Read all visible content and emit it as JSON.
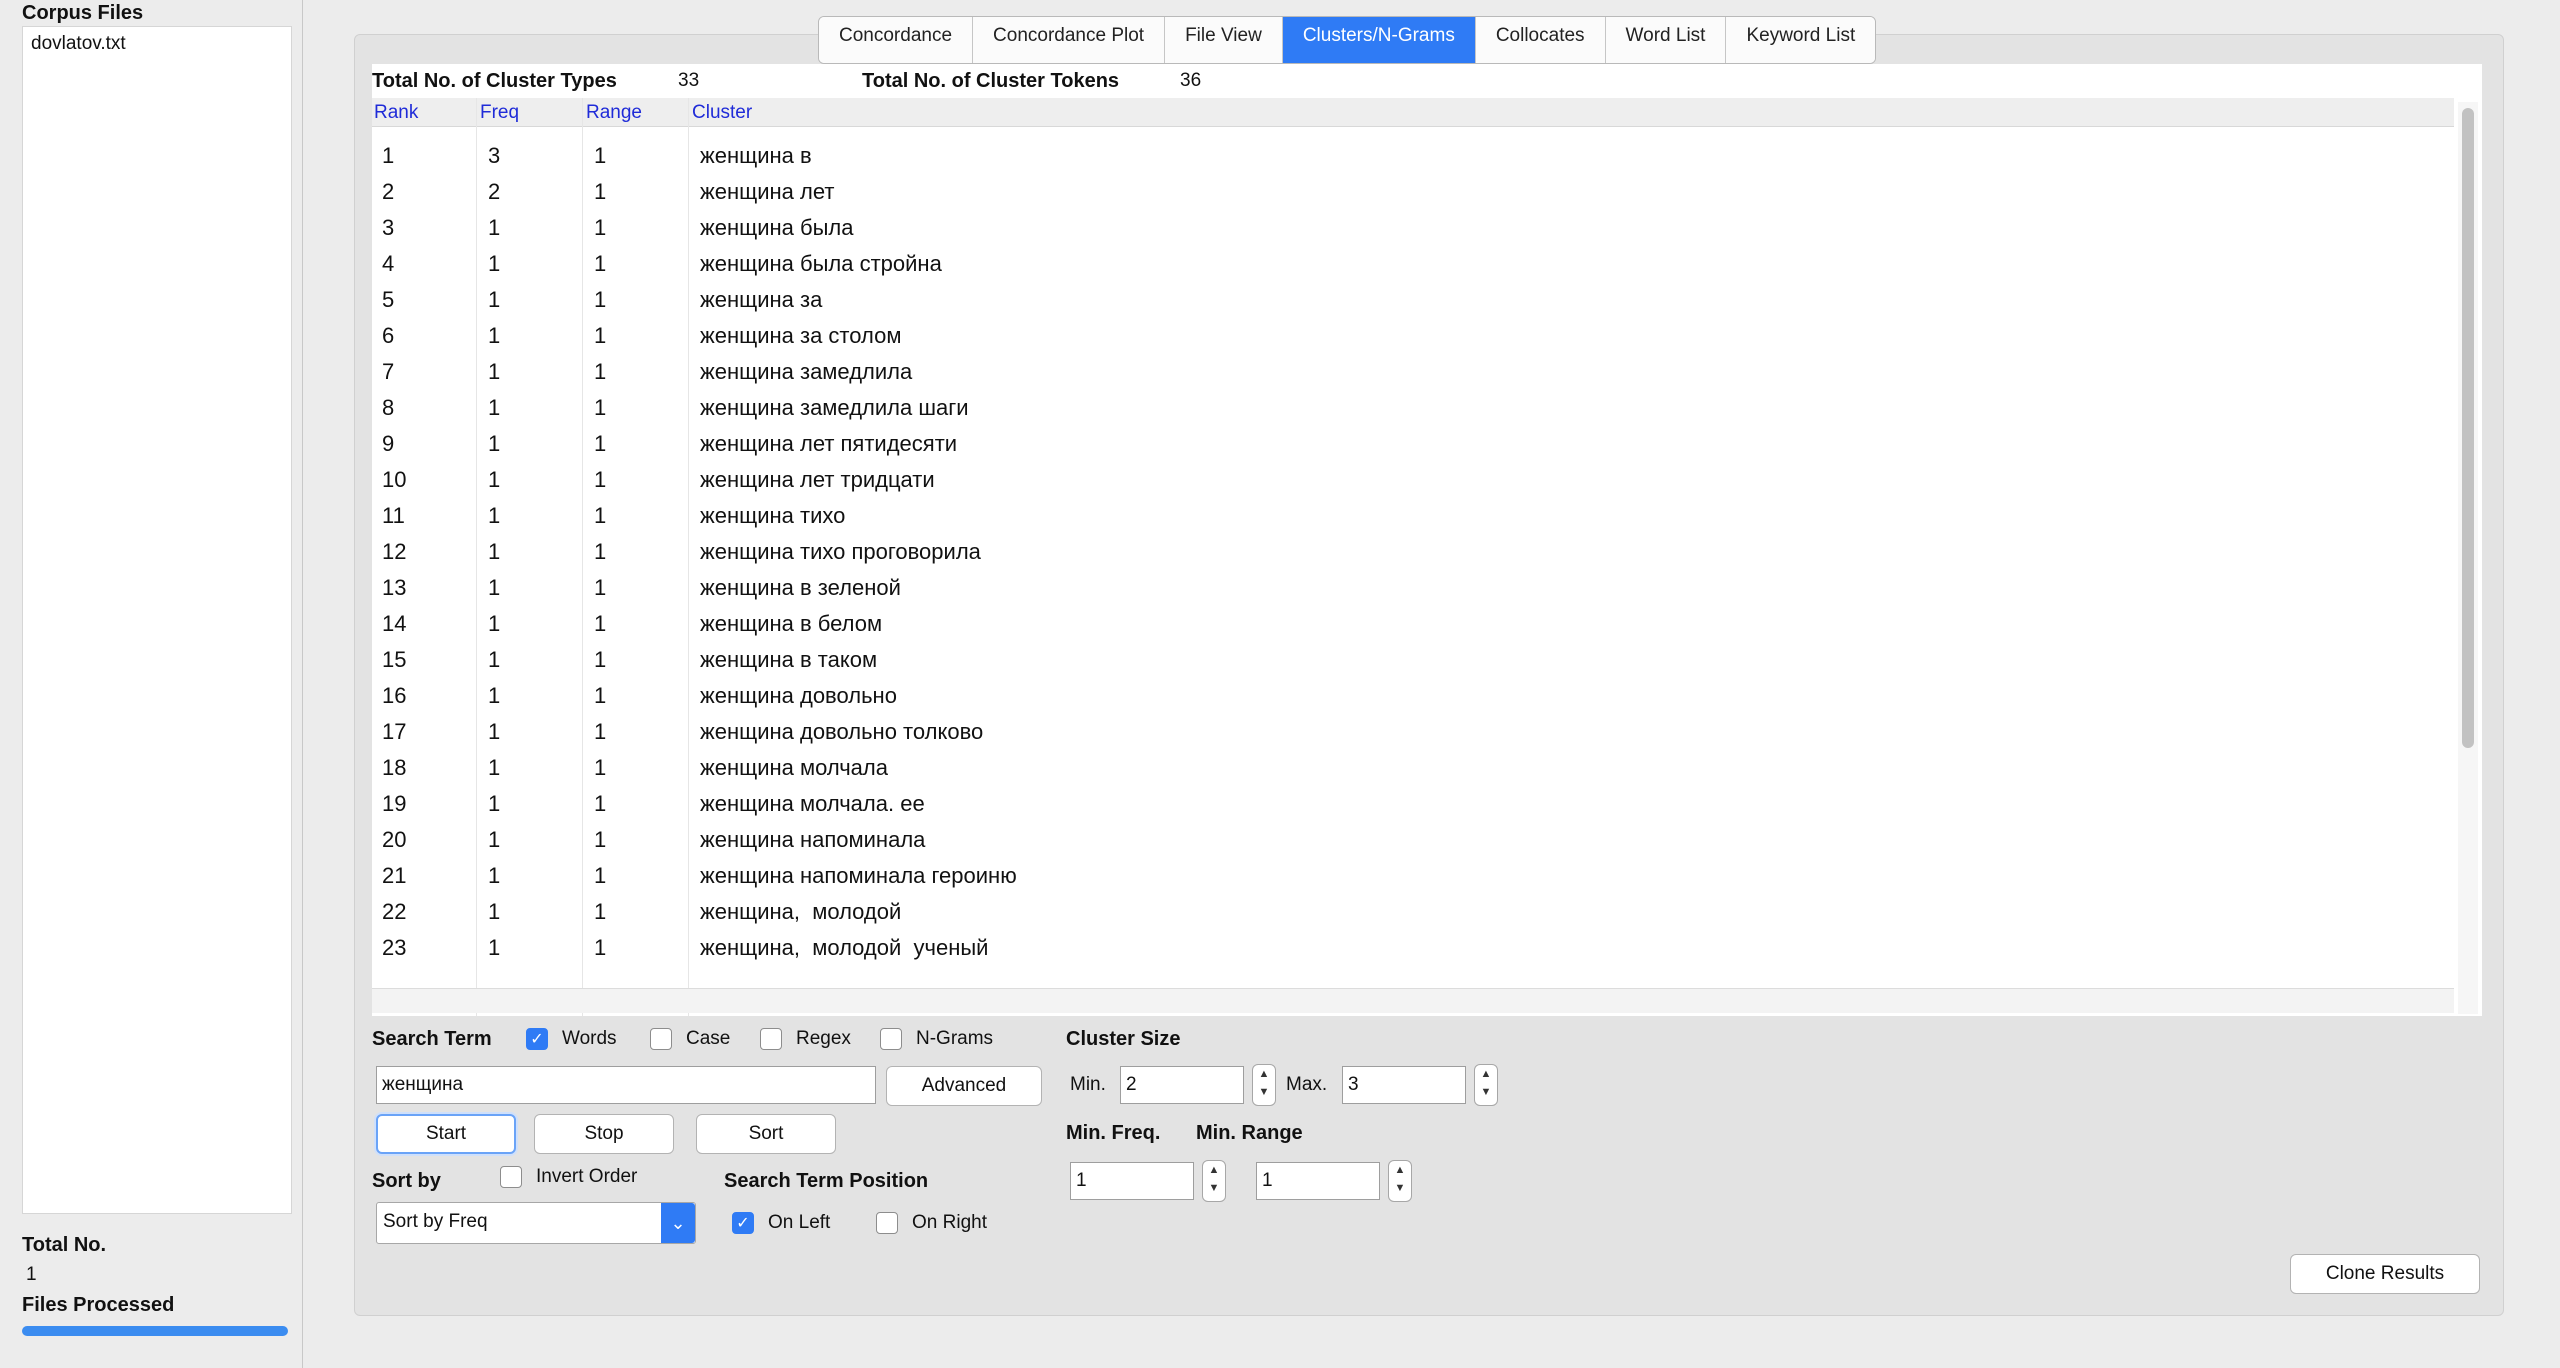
{
  "sidebar": {
    "corpus_title": "Corpus Files",
    "files": [
      "dovlatov.txt"
    ],
    "total_label": "Total No.",
    "total_value": "1",
    "processed_label": "Files Processed"
  },
  "tabs": [
    {
      "label": "Concordance",
      "active": false
    },
    {
      "label": "Concordance Plot",
      "active": false
    },
    {
      "label": "File View",
      "active": false
    },
    {
      "label": "Clusters/N-Grams",
      "active": true
    },
    {
      "label": "Collocates",
      "active": false
    },
    {
      "label": "Word List",
      "active": false
    },
    {
      "label": "Keyword List",
      "active": false
    }
  ],
  "stats": {
    "types_label": "Total No. of Cluster Types",
    "types_value": "33",
    "tokens_label": "Total No. of Cluster Tokens",
    "tokens_value": "36"
  },
  "table": {
    "headers": [
      "Rank",
      "Freq",
      "Range",
      "Cluster"
    ],
    "rows": [
      [
        "1",
        "3",
        "1",
        "женщина в"
      ],
      [
        "2",
        "2",
        "1",
        "женщина лет"
      ],
      [
        "3",
        "1",
        "1",
        "женщина была"
      ],
      [
        "4",
        "1",
        "1",
        "женщина была стройна"
      ],
      [
        "5",
        "1",
        "1",
        "женщина за"
      ],
      [
        "6",
        "1",
        "1",
        "женщина за столом"
      ],
      [
        "7",
        "1",
        "1",
        "женщина замедлила"
      ],
      [
        "8",
        "1",
        "1",
        "женщина замедлила шаги"
      ],
      [
        "9",
        "1",
        "1",
        "женщина лет пятидесяти"
      ],
      [
        "10",
        "1",
        "1",
        "женщина лет тридцати"
      ],
      [
        "11",
        "1",
        "1",
        "женщина тихо"
      ],
      [
        "12",
        "1",
        "1",
        "женщина тихо проговорила"
      ],
      [
        "13",
        "1",
        "1",
        "женщина в зеленой"
      ],
      [
        "14",
        "1",
        "1",
        "женщина в белом"
      ],
      [
        "15",
        "1",
        "1",
        "женщина в таком"
      ],
      [
        "16",
        "1",
        "1",
        "женщина довольно"
      ],
      [
        "17",
        "1",
        "1",
        "женщина довольно толково"
      ],
      [
        "18",
        "1",
        "1",
        "женщина молчала"
      ],
      [
        "19",
        "1",
        "1",
        "женщина молчала. ее"
      ],
      [
        "20",
        "1",
        "1",
        "женщина напоминала"
      ],
      [
        "21",
        "1",
        "1",
        "женщина напоминала героиню"
      ],
      [
        "22",
        "1",
        "1",
        "женщина,  молодой"
      ],
      [
        "23",
        "1",
        "1",
        "женщина,  молодой  ученый"
      ]
    ]
  },
  "search": {
    "label": "Search Term",
    "words_label": "Words",
    "words_checked": true,
    "case_label": "Case",
    "case_checked": false,
    "regex_label": "Regex",
    "regex_checked": false,
    "ngrams_label": "N-Grams",
    "ngrams_checked": false,
    "value": "женщина",
    "advanced_label": "Advanced"
  },
  "buttons": {
    "start": "Start",
    "stop": "Stop",
    "sort": "Sort",
    "clone": "Clone Results"
  },
  "sort": {
    "label": "Sort by",
    "invert_label": "Invert Order",
    "invert_checked": false,
    "selected": "Sort by Freq"
  },
  "position": {
    "label": "Search Term Position",
    "left_label": "On Left",
    "left_checked": true,
    "right_label": "On Right",
    "right_checked": false
  },
  "cluster_size": {
    "label": "Cluster Size",
    "min_label": "Min.",
    "min_value": "2",
    "max_label": "Max.",
    "max_value": "3"
  },
  "thresholds": {
    "freq_label": "Min. Freq.",
    "freq_value": "1",
    "range_label": "Min. Range",
    "range_value": "1"
  },
  "colors": {
    "accent": "#2f7bf5",
    "header_text": "#1f2bd8"
  }
}
